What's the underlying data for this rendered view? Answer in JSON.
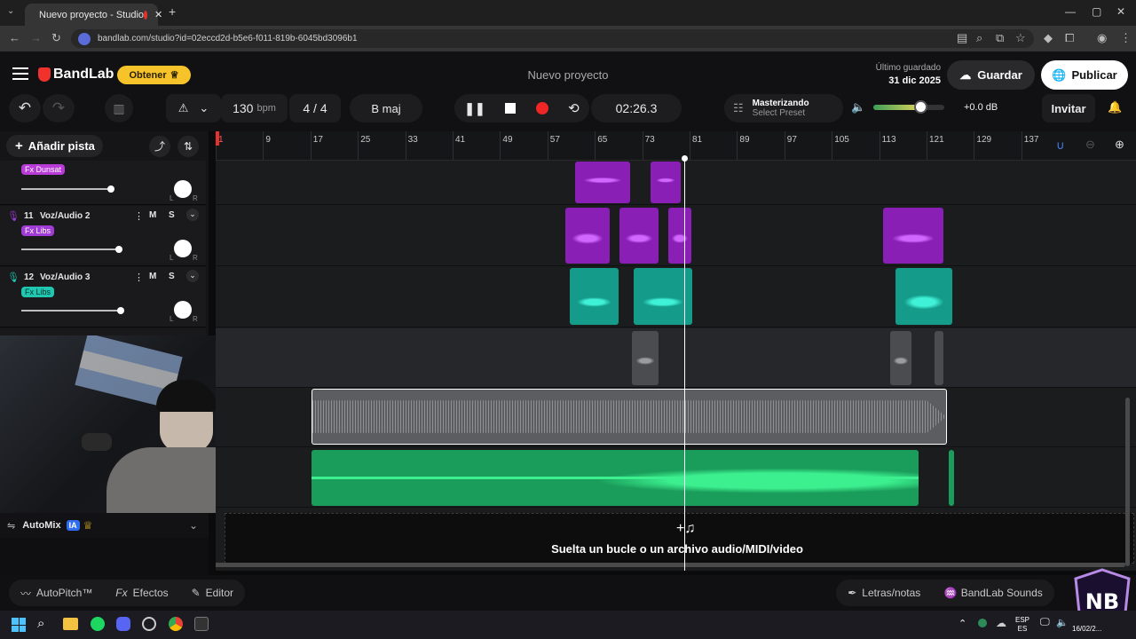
{
  "browser": {
    "tab_title": "Nuevo proyecto - Studio",
    "url": "bandlab.com/studio?id=02eccd2d-b5e6-f011-819b-6045bd3096b1"
  },
  "header": {
    "logo_text": "BandLab",
    "get_button": "Obtener",
    "project_title": "Nuevo proyecto",
    "last_saved_label": "Último guardado",
    "last_saved_date": "31 dic 2025",
    "save_button": "Guardar",
    "publish_button": "Publicar"
  },
  "toolbar": {
    "tempo_value": "130",
    "tempo_unit": "bpm",
    "time_signature": "4 / 4",
    "key": "B maj",
    "time_display": "02:26.3",
    "mastering_title": "Masterizando",
    "mastering_preset": "Select Preset",
    "volume_db": "+0.0 dB",
    "invite_button": "Invitar"
  },
  "tracks_panel": {
    "add_track_button": "Añadir pista",
    "tracks": [
      {
        "fx": "Fx Dunsat",
        "color": "#b83bd8"
      },
      {
        "number": "11",
        "name": "Voz/Audio 2",
        "fx": "Fx Libs",
        "color": "#a03bd6",
        "mute": "M",
        "solo": "S"
      },
      {
        "number": "12",
        "name": "Voz/Audio 3",
        "fx": "Fx Libs",
        "color": "#1fc7b0",
        "mute": "M",
        "solo": "S"
      }
    ],
    "pan_left": "L",
    "pan_right": "R"
  },
  "ruler": {
    "ticks": [
      "1",
      "9",
      "17",
      "25",
      "33",
      "41",
      "49",
      "57",
      "65",
      "73",
      "81",
      "89",
      "97",
      "105",
      "113",
      "121",
      "129",
      "137"
    ]
  },
  "automix": {
    "label": "AutoMix",
    "badge": "IA"
  },
  "dropzone": {
    "text": "Suelta un bucle o un archivo audio/MIDI/video"
  },
  "bottom_bar": {
    "autopitch": "AutoPitch™",
    "effects": "Efectos",
    "editor": "Editor",
    "lyrics": "Letras/notas",
    "sounds": "BandLab Sounds"
  },
  "taskbar": {
    "lang_top": "ESP",
    "lang_bottom": "ES",
    "date": "16/02/2..."
  }
}
